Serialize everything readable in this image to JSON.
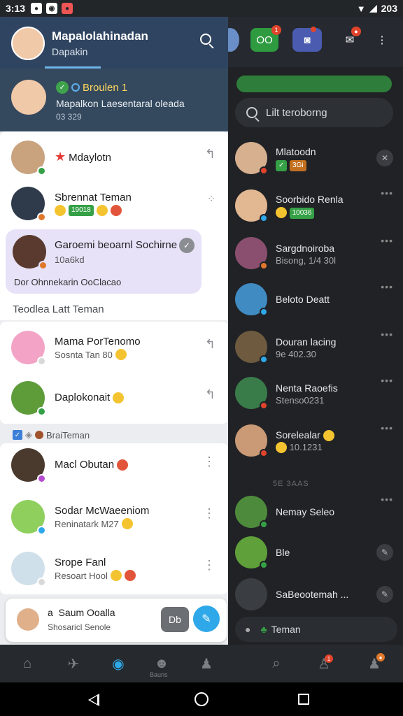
{
  "status_bar": {
    "time": "3:13",
    "battery": "203"
  },
  "drawer": {
    "title": "Mapalolahinadan",
    "subtitle": "Dapakin",
    "featured": {
      "tag": "Broulen 1",
      "message": "Mapalkon Laesentaral oleada",
      "meta": "03 329"
    },
    "rows": [
      {
        "name": "Mdaylotn",
        "sub": ""
      },
      {
        "name": "Sbrennat Teman",
        "sub": "19018"
      },
      {
        "name": "Garoemi beoarnl Sochirne",
        "sub": "10a6kd",
        "extra": "Dor Ohnnekarin OoClacao"
      }
    ],
    "section": "Teodlea Latt Teman",
    "rows2": [
      {
        "name": "Mama PorTenomo",
        "sub": "Sosnta Tan 80"
      },
      {
        "name": "Daplokonait",
        "sub": ""
      }
    ],
    "mini_label": "BraiTeman",
    "rows3": [
      {
        "name": "Macl Obutan",
        "sub": ""
      },
      {
        "name": "Sodar McWaeeniom",
        "sub": "Reninatark M27"
      },
      {
        "name": "Srope Fanl",
        "sub": "Resoart Hool"
      }
    ],
    "compose": {
      "line1": "Saum Ooalla",
      "line2": "Shosaricl Senole",
      "button1": "Db",
      "prefix": "a"
    }
  },
  "right_panel": {
    "header_badge": "OO",
    "search": "Lilt teroborng",
    "rows": [
      {
        "name": "Mlatoodn",
        "sub": "3Gi"
      },
      {
        "name": "Soorbido Renla",
        "sub": "10036"
      },
      {
        "name": "Sargdnoiroba",
        "sub": "Bisong, 1/4 30l"
      },
      {
        "name": "Beloto Deatt",
        "sub": ""
      },
      {
        "name": "Douran lacing",
        "sub": "9e 402.30"
      },
      {
        "name": "Nenta Raoefis",
        "sub": "Stenso0231"
      },
      {
        "name": "Sorelealar",
        "sub": "10.1231"
      }
    ],
    "section": "5E 3AAS",
    "rows_b": [
      {
        "name": "Nemay Seleo",
        "sub": ""
      },
      {
        "name": "Ble",
        "sub": ""
      },
      {
        "name": "SaBeootemah ...",
        "sub": ""
      }
    ],
    "bottom": "Teman"
  },
  "nav": {
    "label": "Bauns"
  },
  "colors": {
    "drawer_header": "#34495e",
    "accent": "#2ea8e8",
    "selected_bg": "#e7e2f8"
  }
}
